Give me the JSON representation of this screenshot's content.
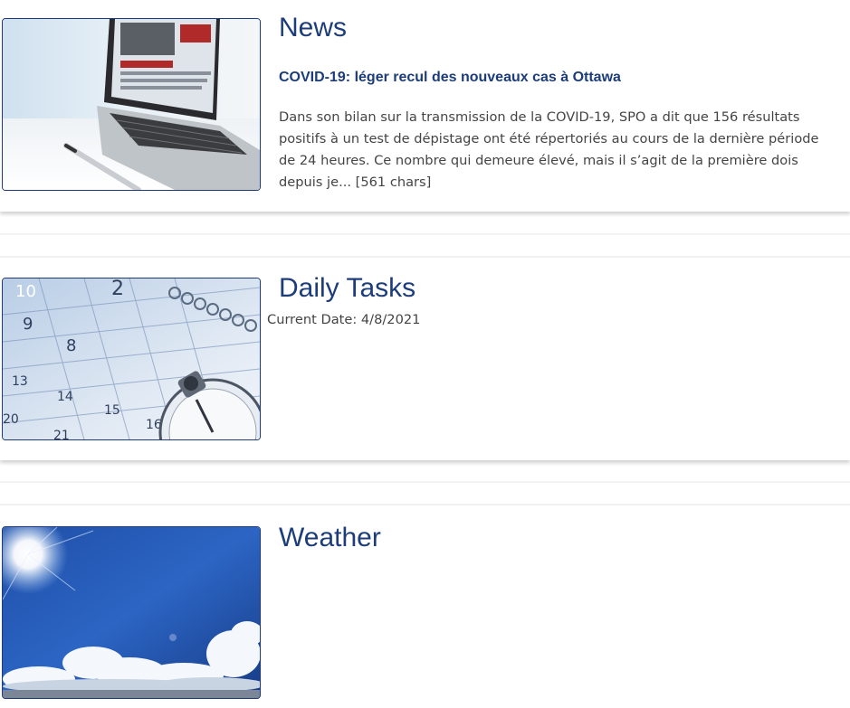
{
  "news": {
    "title": "News",
    "headline": "COVID-19: léger recul des nouveaux cas à Ottawa",
    "summary": "Dans son bilan sur la transmission de la COVID-19, SPO a dit que 156 résultats positifs à un test de dépistage ont été répertoriés au cours de la dernière période de 24 heures. Ce nombre qui demeure élevé, mais il s’agit de la première dois depuis je... [561 chars]"
  },
  "daily_tasks": {
    "title": "Daily Tasks",
    "current_date": "Current Date: 4/8/2021"
  },
  "weather": {
    "title": "Weather"
  },
  "colors": {
    "accent": "#1c3d7a",
    "body_text": "#444444"
  }
}
